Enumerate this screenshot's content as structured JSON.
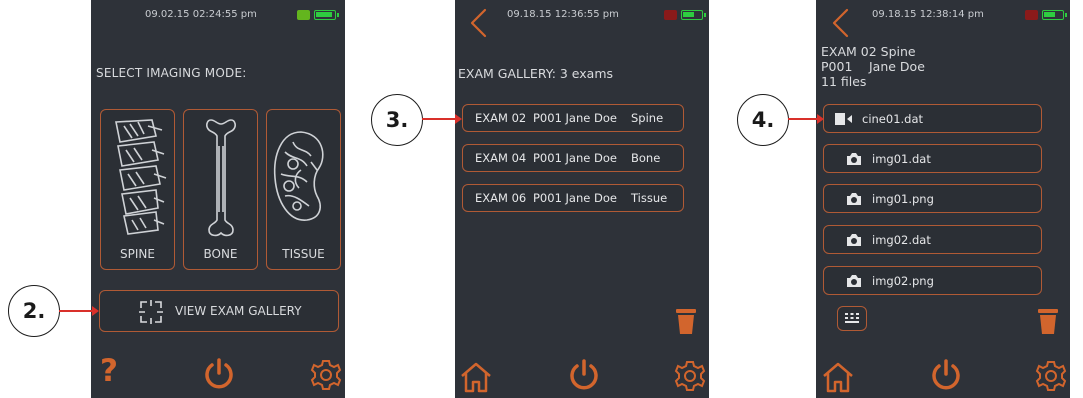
{
  "screen1": {
    "status": {
      "datetime": "09.02.15  02:24:55 pm"
    },
    "prompt": "SELECT IMAGING MODE:",
    "modes": [
      {
        "label": "SPINE",
        "icon": "spine-icon"
      },
      {
        "label": "BONE",
        "icon": "bone-icon"
      },
      {
        "label": "TISSUE",
        "icon": "kidney-icon"
      }
    ],
    "gallery_button": "VIEW EXAM GALLERY",
    "callout": "2."
  },
  "screen2": {
    "status": {
      "datetime": "09.18.15  12:36:55 pm"
    },
    "heading": "EXAM GALLERY: 3 exams",
    "exams": [
      {
        "exam": "EXAM 02",
        "patient": "P001 Jane Doe",
        "type": "Spine"
      },
      {
        "exam": "EXAM 04",
        "patient": "P001 Jane Doe",
        "type": "Bone"
      },
      {
        "exam": "EXAM 06",
        "patient": "P001 Jane Doe",
        "type": "Tissue"
      }
    ],
    "callout": "3."
  },
  "screen3": {
    "status": {
      "datetime": "09.18.15  12:38:14 pm"
    },
    "header_line1": "EXAM 02 Spine",
    "header_line2_id": "P001",
    "header_line2_name": "Jane Doe",
    "header_line3": "11 files",
    "files": [
      {
        "name": "cine01.dat",
        "icon": "video-icon"
      },
      {
        "name": "img01.dat",
        "icon": "camera-icon"
      },
      {
        "name": "img01.png",
        "icon": "camera-icon"
      },
      {
        "name": "img02.dat",
        "icon": "camera-icon"
      },
      {
        "name": "img02.png",
        "icon": "camera-icon"
      }
    ],
    "callout": "4."
  },
  "colors": {
    "accent": "#d2652d",
    "screen_bg": "#2e3239",
    "battery": "#2ecc40",
    "arrow": "#d9302a"
  }
}
